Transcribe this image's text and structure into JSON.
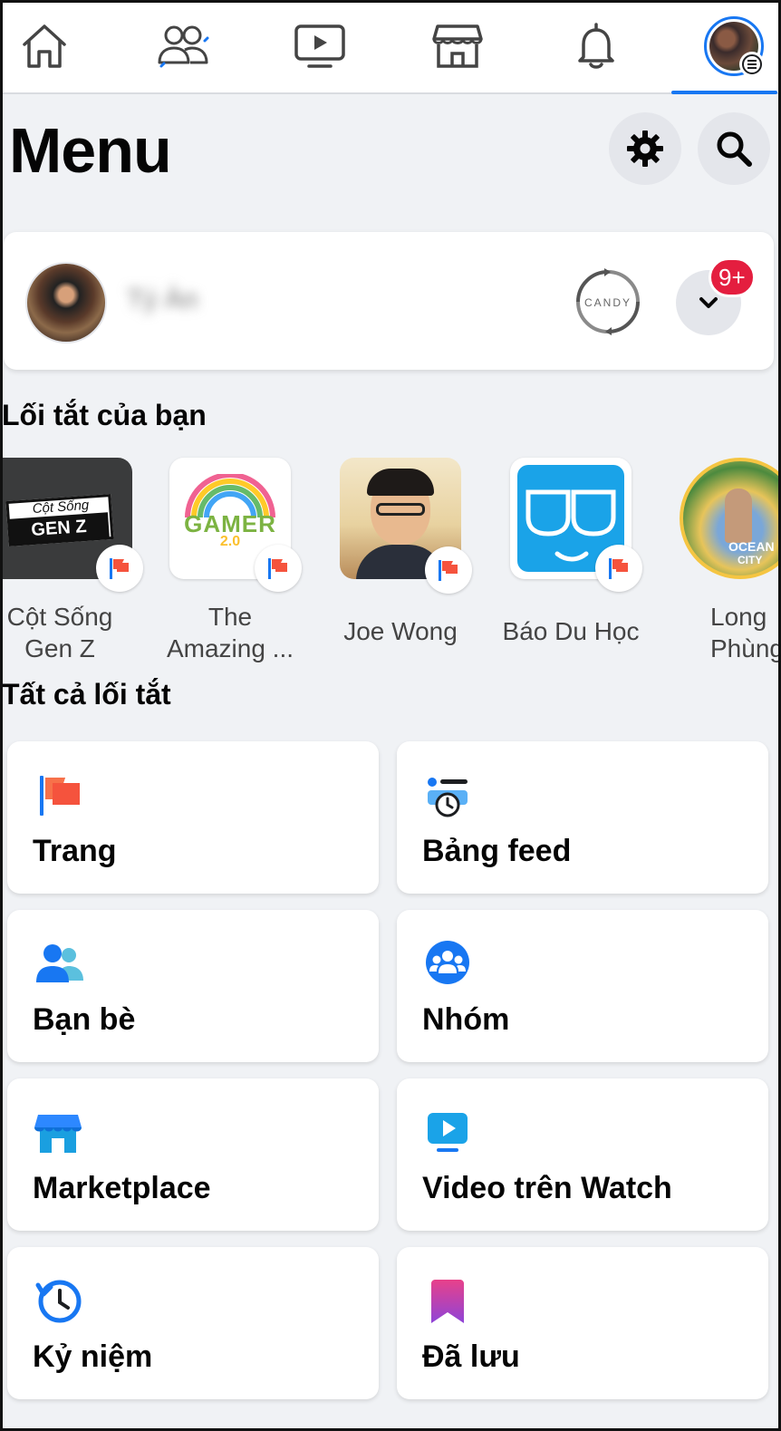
{
  "nav": {
    "items": [
      {
        "name": "home"
      },
      {
        "name": "friends"
      },
      {
        "name": "watch"
      },
      {
        "name": "marketplace"
      },
      {
        "name": "notifications"
      },
      {
        "name": "menu-profile"
      }
    ],
    "active": "menu-profile"
  },
  "header": {
    "title": "Menu"
  },
  "profile": {
    "name": "Tý Àn",
    "page_logo_text": "CANDY",
    "notification_count": "9+"
  },
  "shortcuts": {
    "title": "Lối tắt của bạn",
    "items": [
      {
        "line1": "Cột Sống",
        "line2": "Gen Z"
      },
      {
        "line1": "The",
        "line2": "Amazing ..."
      },
      {
        "line1": "Joe Wong",
        "line2": ""
      },
      {
        "line1": "Báo Du Học",
        "line2": ""
      },
      {
        "line1": "Long",
        "line2": "Phùng"
      }
    ],
    "thumb_texts": {
      "cot_song_top": "Cột Sống",
      "cot_song_bottom": "GEN Z",
      "gamer": "GAMER",
      "gamer_ver": "2.0",
      "ocean": "OCEAN",
      "city": "CITY"
    }
  },
  "all_shortcuts": {
    "title": "Tất cả lối tắt",
    "tiles": [
      {
        "label": "Trang",
        "icon": "pages-flag-icon"
      },
      {
        "label": "Bảng feed",
        "icon": "feed-clock-icon"
      },
      {
        "label": "Bạn bè",
        "icon": "friends-icon"
      },
      {
        "label": "Nhóm",
        "icon": "groups-icon"
      },
      {
        "label": "Marketplace",
        "icon": "marketplace-store-icon"
      },
      {
        "label": "Video trên Watch",
        "icon": "watch-video-icon"
      },
      {
        "label": "Kỷ niệm",
        "icon": "memories-clock-icon"
      },
      {
        "label": "Đã lưu",
        "icon": "saved-bookmark-icon"
      }
    ]
  },
  "colors": {
    "accent": "#1877f2",
    "badge_red": "#e41e3f",
    "background": "#f0f2f5"
  }
}
